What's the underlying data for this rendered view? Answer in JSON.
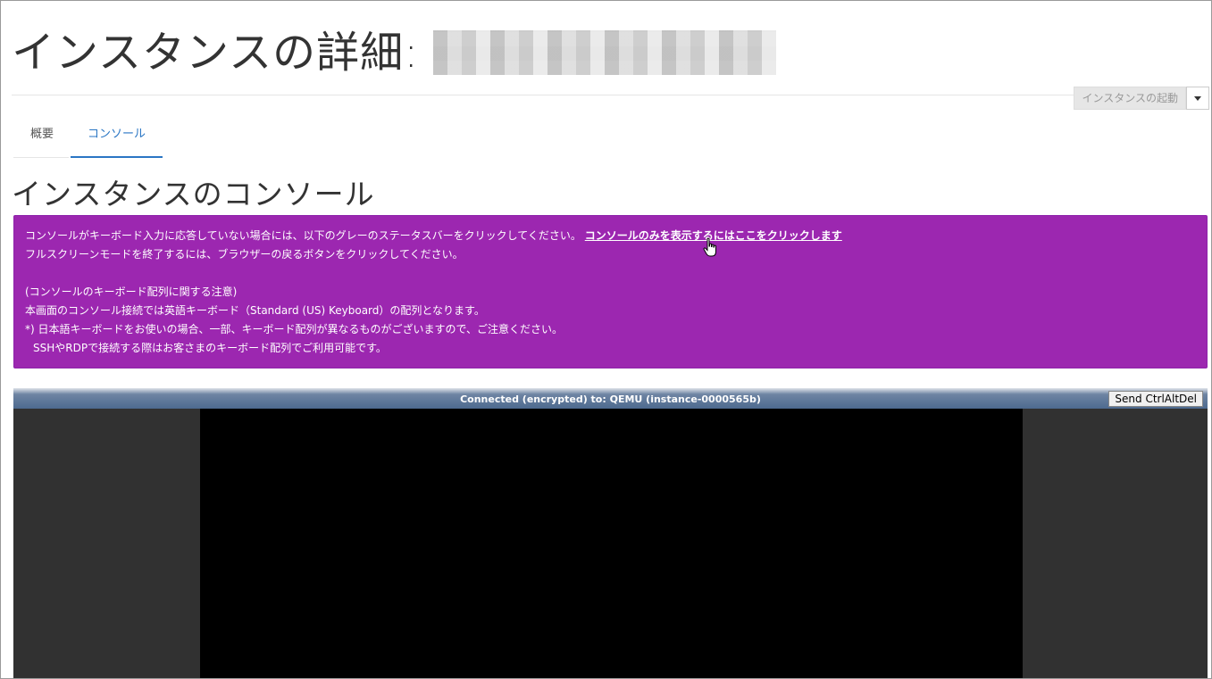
{
  "page": {
    "title": "インスタンスの詳細:",
    "launch_button": "インスタンスの起動"
  },
  "tabs": [
    {
      "label": "概要",
      "active": false
    },
    {
      "label": "コンソール",
      "active": true
    }
  ],
  "section": {
    "title": "インスタンスのコンソール"
  },
  "alert": {
    "line1": "コンソールがキーボード入力に応答していない場合には、以下のグレーのステータスバーをクリックしてください。",
    "link": "コンソールのみを表示するにはここをクリックします",
    "line2": "フルスクリーンモードを終了するには、ブラウザーの戻るボタンをクリックしてください。",
    "note_title": "(コンソールのキーボード配列に関する注意)",
    "note1": "本画面のコンソール接続では英語キーボード（Standard (US) Keyboard）の配列となります。",
    "note2": "*) 日本語キーボードをお使いの場合、一部、キーボード配列が異なるものがございますので、ご注意ください。",
    "note3": "SSHやRDPで接続する際はお客さまのキーボード配列でご利用可能です。"
  },
  "console": {
    "status": "Connected (encrypted) to: QEMU (instance-0000565b)",
    "send_button": "Send CtrlAltDel"
  },
  "colors": {
    "alert_bg": "#9c27b0",
    "tab_active": "#2a76c4",
    "console_bg": "#313131",
    "screen_bg": "#000000"
  },
  "icons": [
    "chevron-down-icon",
    "hand-pointer-icon"
  ]
}
